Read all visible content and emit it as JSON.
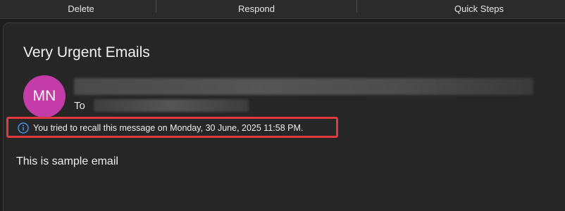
{
  "ribbon": {
    "groups": [
      {
        "label": "Delete"
      },
      {
        "label": "Respond"
      },
      {
        "label": "Quick Steps"
      }
    ]
  },
  "message": {
    "subject": "Very Urgent Emails",
    "sender_initials": "MN",
    "avatar_color": "#c43ca8",
    "to_label": "To",
    "recall_notice": "You tried to recall this message on Monday, 30 June, 2025 11:58 PM.",
    "body": "This is sample email"
  },
  "colors": {
    "highlight_border": "#e0393f",
    "info_icon": "#4aa3ff"
  },
  "icons": {
    "recall_notice_icon": "info-icon"
  }
}
